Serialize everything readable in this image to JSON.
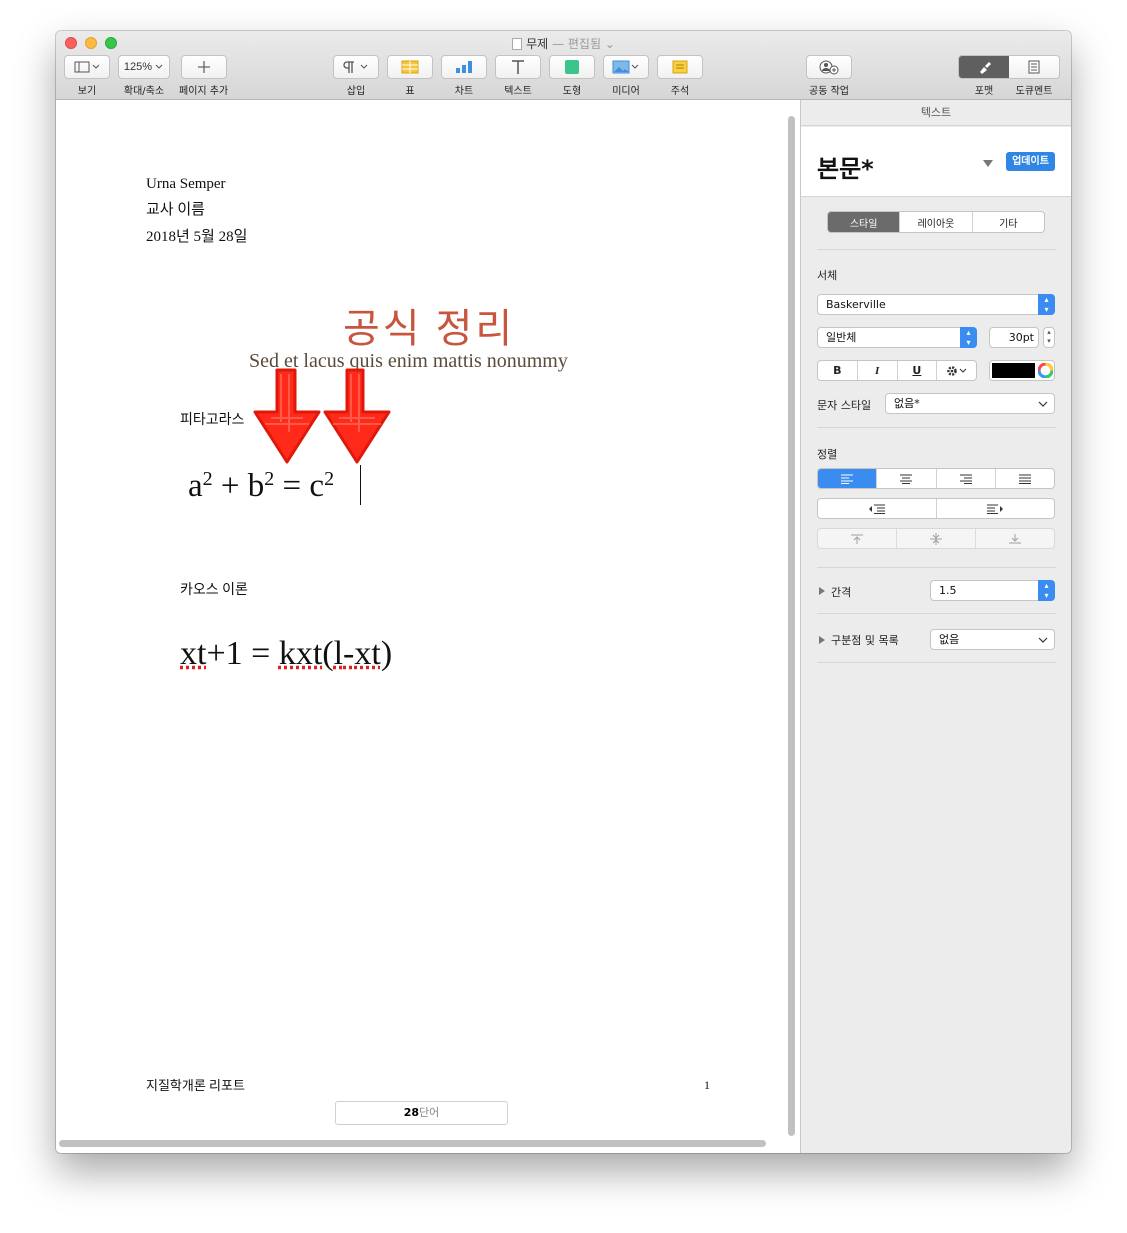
{
  "window": {
    "title": "무제",
    "edited": "— 편집됨",
    "chevron": "⌄"
  },
  "toolbar": {
    "view": {
      "label": "보기"
    },
    "zoom": {
      "value": "125%",
      "label": "확대/축소"
    },
    "add_page": {
      "label": "페이지 추가"
    },
    "insert": {
      "label": "삽입"
    },
    "table": {
      "label": "표"
    },
    "chart": {
      "label": "차트"
    },
    "text": {
      "label": "텍스트"
    },
    "shape": {
      "label": "도형"
    },
    "media": {
      "label": "미디어"
    },
    "comment": {
      "label": "주석"
    },
    "collaborate": {
      "label": "공동 작업"
    },
    "format": {
      "label": "포맷"
    },
    "document": {
      "label": "도큐멘트"
    }
  },
  "document": {
    "header_lines": [
      "Urna Semper",
      "교사 이름",
      "2018년 5월 28일"
    ],
    "title": "공식 정리",
    "subtitle": "Sed et lacus quis enim mattis nonummy",
    "section1_label": "피타고라스",
    "equation1": {
      "a": "a",
      "plus": "+",
      "b": "b",
      "eq": "=",
      "c": "c",
      "exp": "2"
    },
    "section2_label": "카오스 이론",
    "equation2": {
      "xt": "xt",
      "rest1": "+1 = ",
      "kxt": "kxt",
      "paren_open": "(",
      "l": "l",
      "dash": "-",
      "xt2": "xt",
      "paren_close": ")"
    },
    "footer_left": "지질학개론 리포트",
    "page_number": "1",
    "word_count": {
      "number": "28",
      "unit": "단어"
    }
  },
  "sidebar": {
    "header": "텍스트",
    "style_name": "본문*",
    "update_button": "업데이트",
    "tabs": [
      "스타일",
      "레이아웃",
      "기타"
    ],
    "font_section": "서체",
    "font_family": "Baskerville",
    "font_typeface": "일반체",
    "font_size": "30pt",
    "bold": "B",
    "italic": "I",
    "underline": "U",
    "text_color": "#000000",
    "char_style_label": "문자 스타일",
    "char_style_value": "없음*",
    "alignment_section": "정렬",
    "spacing_label": "간격",
    "spacing_value": "1.5",
    "bullets_label": "구분점 및 목록",
    "bullets_value": "없음"
  },
  "colors": {
    "title_color": "#c8553d",
    "subtitle_color": "#5a4a3a",
    "accent_blue": "#3b8cf0",
    "arrow_red": "#ff2a1a"
  }
}
